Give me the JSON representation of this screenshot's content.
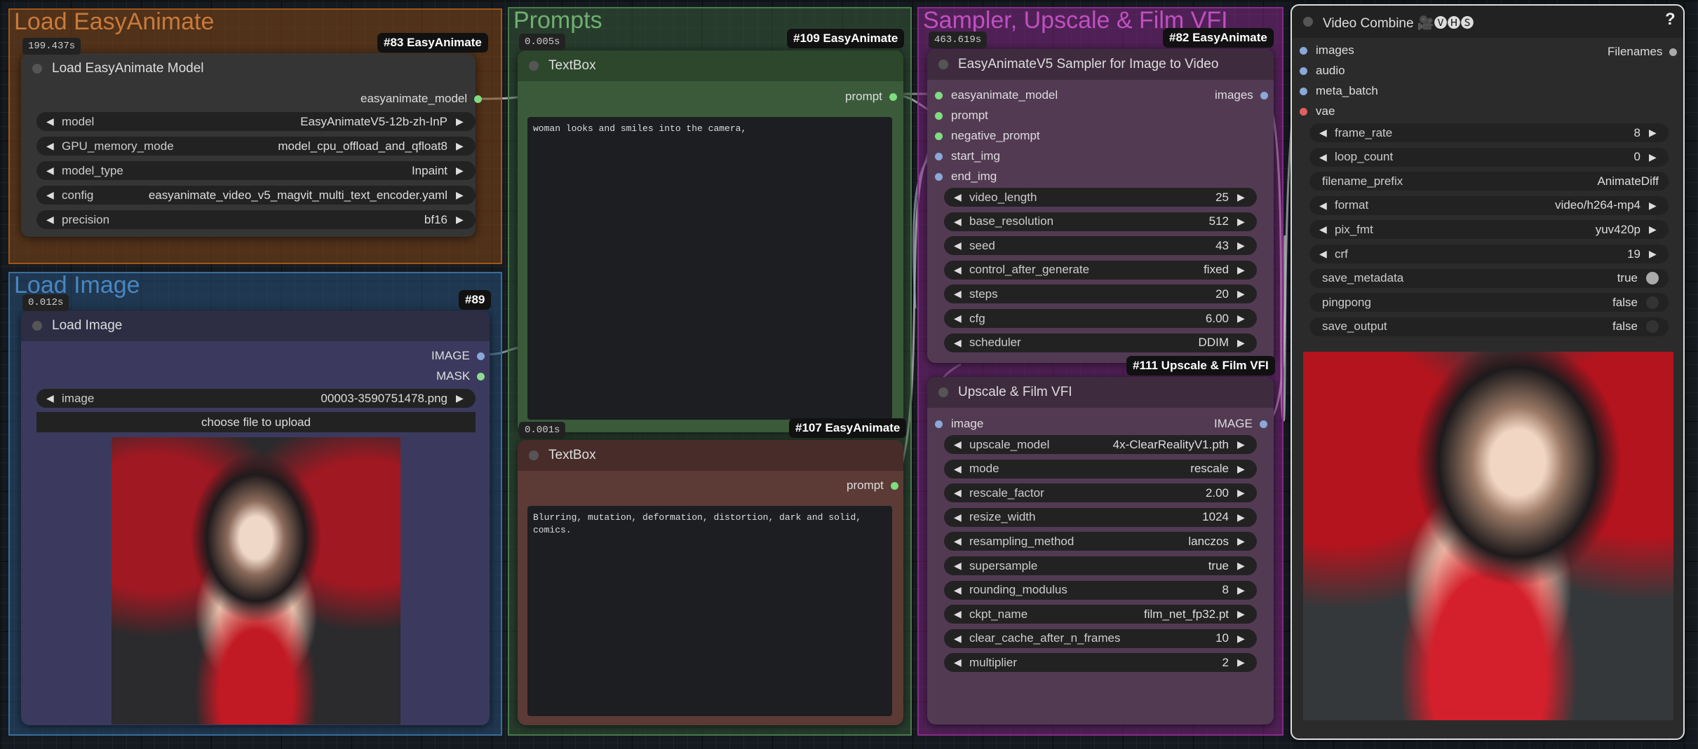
{
  "groups": {
    "load_easyanimate": {
      "title": "Load EasyAnimate"
    },
    "load_image": {
      "title": "Load Image"
    },
    "prompts": {
      "title": "Prompts"
    },
    "sampler": {
      "title": "Sampler, Upscale & Film VFI"
    }
  },
  "load_model_node": {
    "time": "199.437s",
    "badge": "#83 EasyAnimate",
    "title": "Load EasyAnimate Model",
    "output": "easyanimate_model",
    "widgets": [
      {
        "label": "model",
        "value": "EasyAnimateV5-12b-zh-InP"
      },
      {
        "label": "GPU_memory_mode",
        "value": "model_cpu_offload_and_qfloat8"
      },
      {
        "label": "model_type",
        "value": "Inpaint"
      },
      {
        "label": "config",
        "value": "easyanimate_video_v5_magvit_multi_text_encoder.yaml"
      },
      {
        "label": "precision",
        "value": "bf16"
      }
    ]
  },
  "load_image_node": {
    "time": "0.012s",
    "badge": "#89",
    "title": "Load Image",
    "outputs": [
      "IMAGE",
      "MASK"
    ],
    "image_label": "image",
    "image_value": "00003-3590751478.png",
    "upload_label": "choose file to upload"
  },
  "textbox_positive": {
    "time": "0.005s",
    "badge": "#109 EasyAnimate",
    "title": "TextBox",
    "output": "prompt",
    "text": "woman looks and smiles into the camera,"
  },
  "textbox_negative": {
    "time": "0.001s",
    "badge": "#107 EasyAnimate",
    "title": "TextBox",
    "output": "prompt",
    "text": "Blurring, mutation, deformation, distortion, dark and solid, comics."
  },
  "sampler_node": {
    "time": "463.619s",
    "badge": "#82 EasyAnimate",
    "title": "EasyAnimateV5 Sampler for Image to Video",
    "inputs": [
      "easyanimate_model",
      "prompt",
      "negative_prompt",
      "start_img",
      "end_img"
    ],
    "output": "images",
    "widgets": [
      {
        "label": "video_length",
        "value": "25"
      },
      {
        "label": "base_resolution",
        "value": "512"
      },
      {
        "label": "seed",
        "value": "43"
      },
      {
        "label": "control_after_generate",
        "value": "fixed"
      },
      {
        "label": "steps",
        "value": "20"
      },
      {
        "label": "cfg",
        "value": "6.00"
      },
      {
        "label": "scheduler",
        "value": "DDIM"
      }
    ]
  },
  "upscale_node": {
    "badge": "#111 Upscale & Film VFI",
    "title": "Upscale & Film VFI",
    "input": "image",
    "output": "IMAGE",
    "widgets": [
      {
        "label": "upscale_model",
        "value": "4x-ClearRealityV1.pth"
      },
      {
        "label": "mode",
        "value": "rescale"
      },
      {
        "label": "rescale_factor",
        "value": "2.00"
      },
      {
        "label": "resize_width",
        "value": "1024"
      },
      {
        "label": "resampling_method",
        "value": "lanczos"
      },
      {
        "label": "supersample",
        "value": "true"
      },
      {
        "label": "rounding_modulus",
        "value": "8"
      },
      {
        "label": "ckpt_name",
        "value": "film_net_fp32.pt"
      },
      {
        "label": "clear_cache_after_n_frames",
        "value": "10"
      },
      {
        "label": "multiplier",
        "value": "2"
      }
    ]
  },
  "video_combine_node": {
    "title": "Video Combine 🎥🅥🅗🅢",
    "help": "?",
    "inputs": [
      "images",
      "audio",
      "meta_batch",
      "vae"
    ],
    "output": "Filenames",
    "widgets": [
      {
        "label": "frame_rate",
        "value": "8"
      },
      {
        "label": "loop_count",
        "value": "0"
      },
      {
        "label": "filename_prefix",
        "value": "AnimateDiff"
      },
      {
        "label": "format",
        "value": "video/h264-mp4"
      },
      {
        "label": "pix_fmt",
        "value": "yuv420p"
      },
      {
        "label": "crf",
        "value": "19"
      },
      {
        "label": "save_metadata",
        "value": "true"
      },
      {
        "label": "pingpong",
        "value": "false"
      },
      {
        "label": "save_output",
        "value": "false"
      }
    ]
  },
  "colors": {
    "easyanimate_group": "#b5651d",
    "image_group": "#3a6e9c",
    "prompts_group": "#5a9a5a",
    "sampler_group": "#a134a0",
    "socket_green": "#7fdc7f",
    "socket_blue": "#8aa8d8",
    "socket_red": "#e06060"
  },
  "icons": {
    "left_arrow": "◀",
    "right_arrow": "▶"
  }
}
